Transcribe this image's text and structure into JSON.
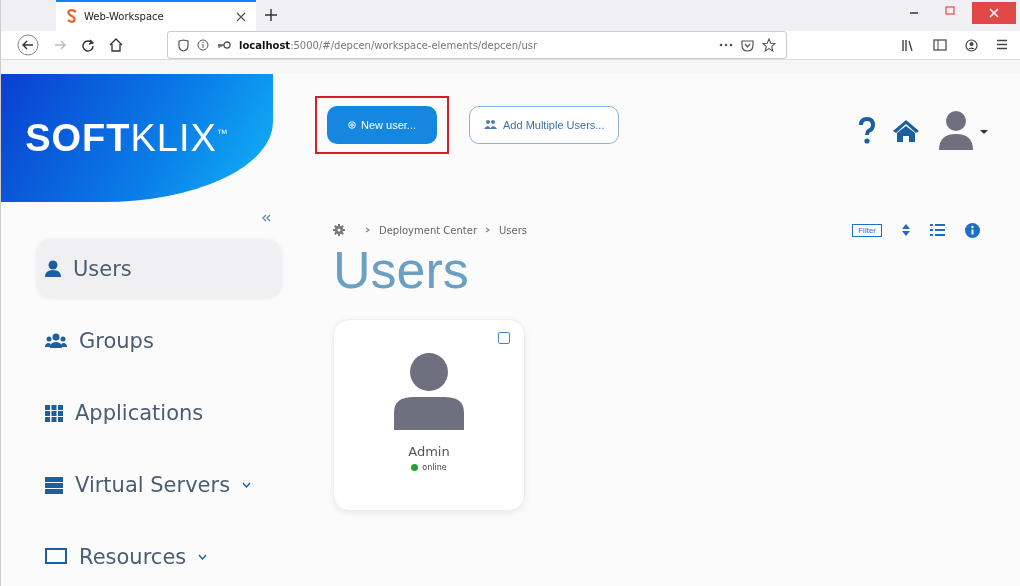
{
  "browser": {
    "tabs": [
      {
        "title": "Web-Workspace",
        "selected": true
      }
    ],
    "url": {
      "host": "localhost",
      "path": ":5000/#/depcen/workspace-elements/depcen/usr"
    }
  },
  "logo": {
    "bold": "SOFT",
    "light": "KLIX",
    "mark": "™"
  },
  "header_buttons": [
    {
      "label": "New user...",
      "kind": "primary",
      "highlighted": true
    },
    {
      "label": "Add Multiple Users...",
      "kind": "outline",
      "highlighted": false
    }
  ],
  "sidebar": {
    "items": [
      {
        "label": "Users",
        "selected": true,
        "expandable": false
      },
      {
        "label": "Groups",
        "selected": false,
        "expandable": false
      },
      {
        "label": "Applications",
        "selected": false,
        "expandable": false
      },
      {
        "label": "Virtual Servers",
        "selected": false,
        "expandable": true
      },
      {
        "label": "Resources",
        "selected": false,
        "expandable": true
      }
    ]
  },
  "breadcrumb": [
    "Deployment Center",
    "Users"
  ],
  "toolbar": {
    "filter": "Filter"
  },
  "page_title": "Users",
  "cards": [
    {
      "name": "Admin",
      "status": "online",
      "color": "#1fa52b",
      "checked": false
    }
  ]
}
